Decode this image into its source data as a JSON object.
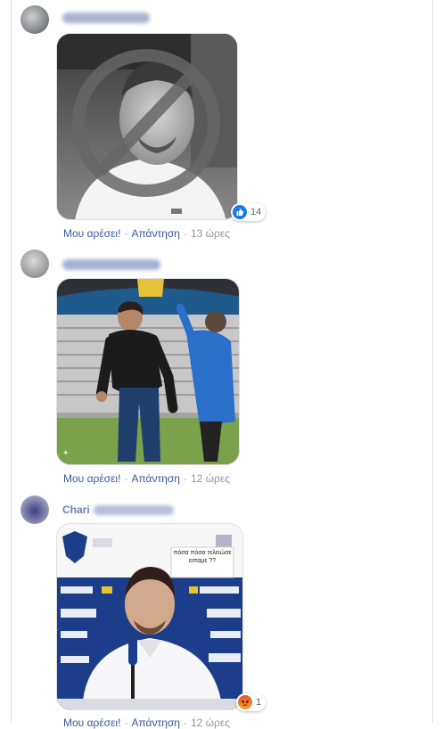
{
  "comments": [
    {
      "author": "",
      "actions": {
        "like": "Μου αρέσει!",
        "reply": "Απάντηση",
        "time": "13 ώρες"
      },
      "reaction": {
        "icon": "like-icon",
        "count": "14",
        "color": "#1877f2"
      }
    },
    {
      "author": "",
      "actions": {
        "like": "Μου αρέσει!",
        "reply": "Απάντηση",
        "time": "12 ώρες"
      }
    },
    {
      "author": "Chari",
      "actions": {
        "like": "Μου αρέσει!",
        "reply": "Απάντηση",
        "time": "12 ώρες"
      },
      "reaction": {
        "icon": "angry-icon",
        "count": "1",
        "color": "#e9710f"
      },
      "image_sign": "πόσα πόσα τελειώσε ειπαμε ??"
    }
  ]
}
